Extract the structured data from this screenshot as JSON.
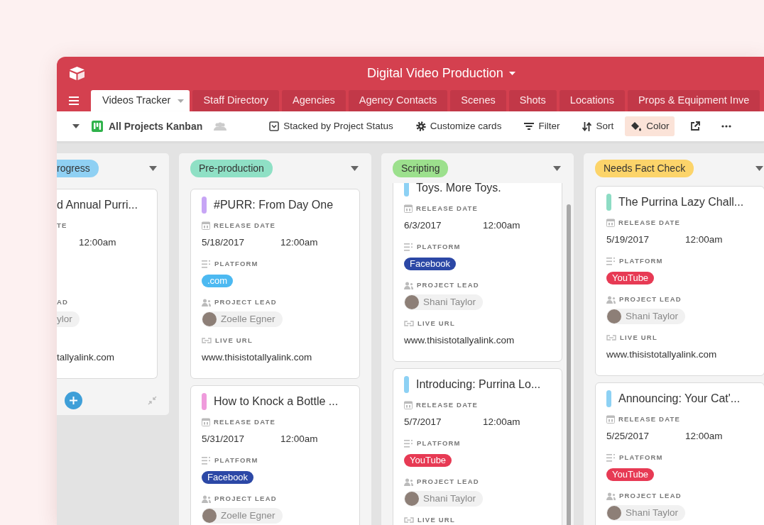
{
  "app": {
    "title": "Digital Video Production"
  },
  "tabs": [
    {
      "label": "Videos Tracker",
      "selected": true
    },
    {
      "label": "Staff Directory",
      "selected": false
    },
    {
      "label": "Agencies",
      "selected": false
    },
    {
      "label": "Agency Contacts",
      "selected": false
    },
    {
      "label": "Scenes",
      "selected": false
    },
    {
      "label": "Shots",
      "selected": false
    },
    {
      "label": "Locations",
      "selected": false
    },
    {
      "label": "Props & Equipment Inve",
      "selected": false
    }
  ],
  "toolbar": {
    "view_name": "All Projects Kanban",
    "items": [
      {
        "kind": "stack",
        "label": "Stacked by Project Status",
        "active": false
      },
      {
        "kind": "customize",
        "label": "Customize cards",
        "active": false
      },
      {
        "kind": "filter",
        "label": "Filter",
        "active": false
      },
      {
        "kind": "sort",
        "label": "Sort",
        "active": false
      },
      {
        "kind": "color",
        "label": "Color",
        "active": true
      },
      {
        "kind": "share",
        "active": false
      },
      {
        "kind": "more",
        "active": false
      }
    ]
  },
  "columns": [
    {
      "kind": "cut",
      "title": "rogress",
      "color": "#8fd0f3",
      "footer": true,
      "scrollbar": false,
      "cards": [
        {
          "title": "d Annual Purri...",
          "release_label": "TE",
          "time": "12:00am",
          "lead_label": "AD",
          "lead": "ylor",
          "avatar": false,
          "url": "tallyalink.com"
        }
      ]
    },
    {
      "kind": "full",
      "title": "Pre-production",
      "color": "#8fe0c5",
      "footer": false,
      "scrollbar": false,
      "cards": [
        {
          "title": "#PURR: From Day One",
          "color": "#c7a5f5",
          "release_label": "RELEASE DATE",
          "date": "5/18/2017",
          "time": "12:00am",
          "platform_label": "PLATFORM",
          "platform": {
            "label": ".com",
            "color": "#4cb9f1"
          },
          "lead_label": "PROJECT LEAD",
          "lead": "Zoelle Egner",
          "avatar": true,
          "url_label": "LIVE URL",
          "url": "www.thisistotallyalink.com"
        },
        {
          "title": "How to Knock a Bottle ...",
          "color": "#ef9bdc",
          "release_label": "RELEASE DATE",
          "date": "5/31/2017",
          "time": "12:00am",
          "platform_label": "PLATFORM",
          "platform": {
            "label": "Facebook",
            "color": "#2c48a6"
          },
          "lead_label": "PROJECT LEAD",
          "lead": "Zoelle Egner",
          "avatar": true
        }
      ]
    },
    {
      "kind": "full",
      "title": "Scripting",
      "color": "#9ce08d",
      "footer": false,
      "scrollbar": true,
      "cards": [
        {
          "title": "Toys. More Toys.",
          "color": "#8dd1f4",
          "release_label": "RELEASE DATE",
          "date": "6/3/2017",
          "time": "12:00am",
          "platform_label": "PLATFORM",
          "platform": {
            "label": "Facebook",
            "color": "#2c48a6"
          },
          "lead_label": "PROJECT LEAD",
          "lead": "Shani Taylor",
          "avatar": true,
          "url_label": "LIVE URL",
          "url": "www.thisistotallyalink.com"
        },
        {
          "title": "Introducing: Purrina Lo...",
          "color": "#8dd1f4",
          "release_label": "RELEASE DATE",
          "date": "5/7/2017",
          "time": "12:00am",
          "platform_label": "PLATFORM",
          "platform": {
            "label": "YouTube",
            "color": "#e73a54"
          },
          "lead_label": "PROJECT LEAD",
          "lead": "Shani Taylor",
          "avatar": true,
          "url_label": "LIVE URL"
        }
      ]
    },
    {
      "kind": "full",
      "title": "Needs Fact Check",
      "color": "#fcd46a",
      "footer": false,
      "scrollbar": false,
      "cards": [
        {
          "title": "The Purrina Lazy Chall...",
          "color": "#8ddcc4",
          "release_label": "RELEASE DATE",
          "date": "5/19/2017",
          "time": "12:00am",
          "platform_label": "PLATFORM",
          "platform": {
            "label": "YouTube",
            "color": "#e73a54"
          },
          "lead_label": "PROJECT LEAD",
          "lead": "Shani Taylor",
          "avatar": true,
          "url_label": "LIVE URL",
          "url": "www.thisistotallyalink.com"
        },
        {
          "title": "Announcing: Your Cat'...",
          "color": "#8dd1f4",
          "release_label": "RELEASE DATE",
          "date": "5/25/2017",
          "time": "12:00am",
          "platform_label": "PLATFORM",
          "platform": {
            "label": "YouTube",
            "color": "#e73a54"
          },
          "lead_label": "PROJECT LEAD",
          "lead": "Shani Taylor",
          "avatar": true
        }
      ]
    }
  ]
}
